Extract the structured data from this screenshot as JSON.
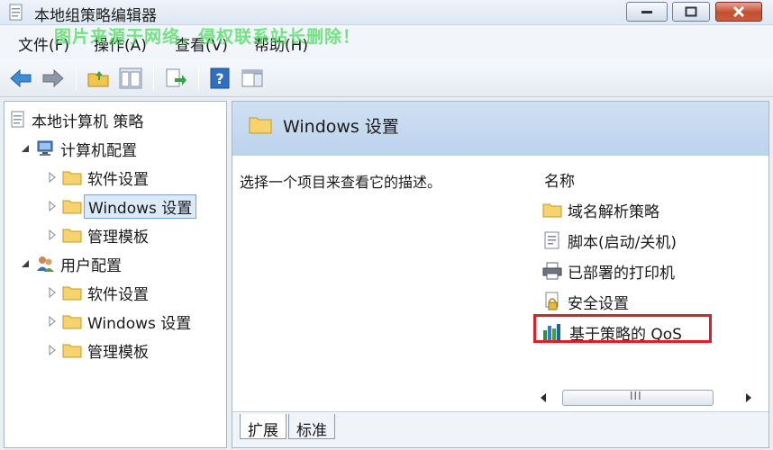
{
  "window": {
    "title": "本地组策略编辑器"
  },
  "menu": {
    "items": [
      "文件(F)",
      "操作(A)",
      "查看(V)",
      "帮助(H)"
    ]
  },
  "watermark": "图片来源于网络，侵权联系站长删除！",
  "tree": {
    "root": "本地计算机 策略",
    "computer_config": "计算机配置",
    "computer_children": [
      "软件设置",
      "Windows 设置",
      "管理模板"
    ],
    "user_config": "用户配置",
    "user_children": [
      "软件设置",
      "Windows 设置",
      "管理模板"
    ]
  },
  "details": {
    "header_title": "Windows 设置",
    "description": "选择一个项目来查看它的描述。",
    "column_name": "名称",
    "items": [
      "域名解析策略",
      "脚本(启动/关机)",
      "已部署的打印机",
      "安全设置",
      "基于策略的 QoS"
    ]
  },
  "tabs": [
    "扩展",
    "标准"
  ],
  "scrollbar": {
    "grip": "III"
  },
  "colors": {
    "highlight_border": "#e11d2a",
    "selection_bg": "#dce9f8",
    "header_band": "#c6daf0",
    "watermark": "#46dc5a"
  }
}
